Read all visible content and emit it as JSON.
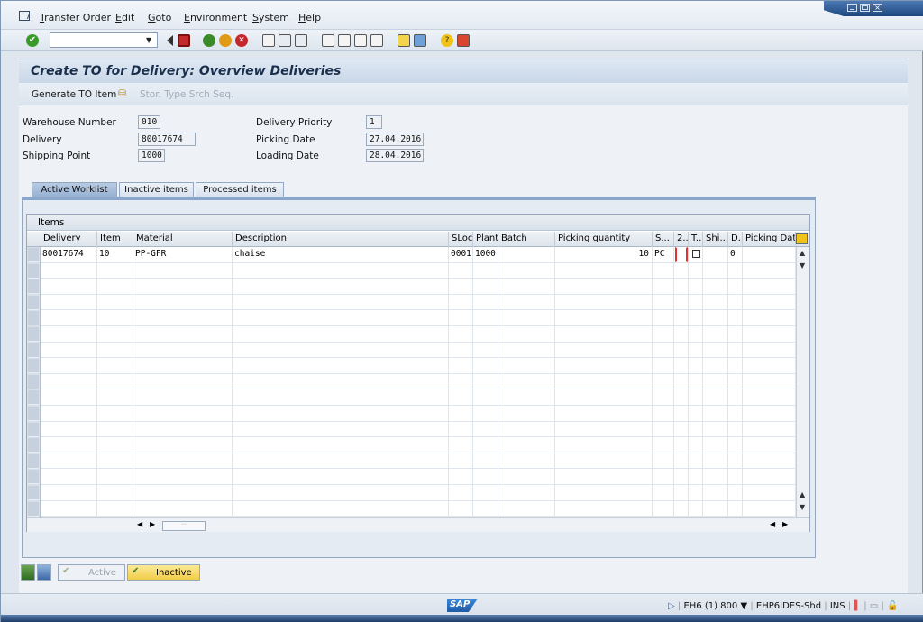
{
  "menu": {
    "items": [
      "Transfer Order",
      "Edit",
      "Goto",
      "Environment",
      "System",
      "Help"
    ]
  },
  "title": "Create TO for Delivery: Overview Deliveries",
  "app_toolbar": {
    "generate_label": "Generate TO Item",
    "stor_label": "Stor. Type Srch Seq."
  },
  "header": {
    "warehouse_label": "Warehouse Number",
    "warehouse_value": "010",
    "delivery_label": "Delivery",
    "delivery_value": "80017674",
    "shipping_label": "Shipping Point",
    "shipping_value": "1000",
    "priority_label": "Delivery Priority",
    "priority_value": "1",
    "picking_date_label": "Picking Date",
    "picking_date_value": "27.04.2016",
    "loading_date_label": "Loading Date",
    "loading_date_value": "28.04.2016"
  },
  "tabs": [
    "Active Worklist",
    "Inactive items",
    "Processed items"
  ],
  "grid": {
    "title": "Items",
    "columns": [
      "Delivery",
      "Item",
      "Material",
      "Description",
      "SLoc",
      "Plant",
      "Batch",
      "Picking quantity",
      "S...",
      "2..",
      "T..",
      "Shi...",
      "D..",
      "Picking Date"
    ],
    "rows": [
      [
        "80017674",
        "10",
        "PP-GFR",
        "chaise",
        "0001",
        "1000",
        "",
        "10",
        "PC",
        "",
        "",
        "",
        "0",
        ""
      ]
    ]
  },
  "bottom": {
    "active_label": "Active",
    "inactive_label": "Inactive"
  },
  "status": {
    "system_info": "EH6 (1) 800",
    "server": "EHP6IDES-Shd",
    "mode": "INS",
    "logo": "SAP"
  },
  "colors": {
    "title_text": "#1a2f4c",
    "tab_active": "#97b2d4",
    "inactive_button": "#f5dc6a"
  }
}
